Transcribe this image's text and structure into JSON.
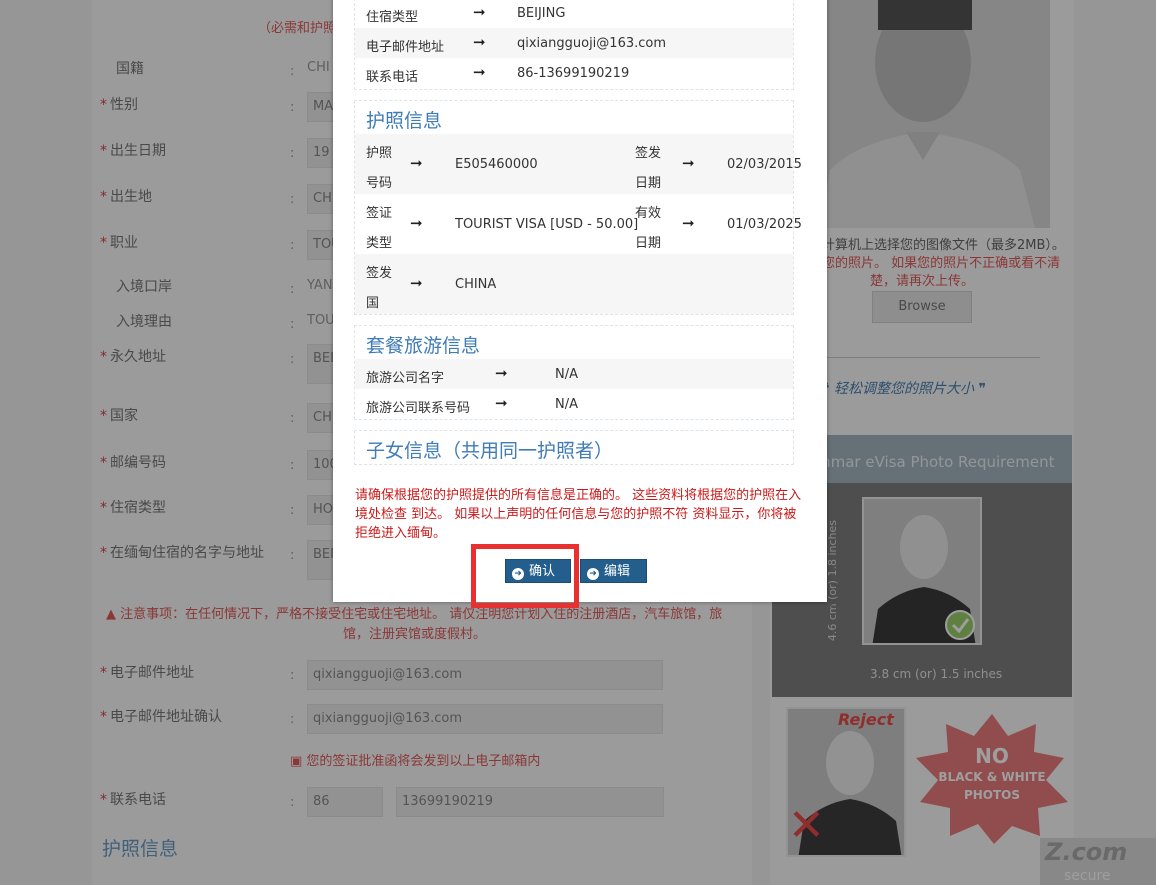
{
  "background": {
    "top_note": "（必需和护照一",
    "fields": [
      {
        "label": "国籍",
        "required": false,
        "value": "CHI"
      },
      {
        "label": "性别",
        "required": true,
        "value": "MA"
      },
      {
        "label": "出生日期",
        "required": true,
        "value": "19"
      },
      {
        "label": "出生地",
        "required": true,
        "value": "CH"
      },
      {
        "label": "职业",
        "required": true,
        "value": "TOU"
      },
      {
        "label": "入境口岸",
        "required": false,
        "value": "YAN"
      },
      {
        "label": "入境理由",
        "required": false,
        "value": "TOU"
      },
      {
        "label": "永久地址",
        "required": true,
        "value": "BEI"
      },
      {
        "label": "国家",
        "required": true,
        "value": "CH"
      },
      {
        "label": "邮编号码",
        "required": true,
        "value": "100"
      },
      {
        "label": "住宿类型",
        "required": true,
        "value": "HO"
      },
      {
        "label": "在缅甸住宿的名字与地址",
        "required": true,
        "value": "BEI"
      }
    ],
    "notice": "注意事项：在任何情况下，严格不接受住宅或住宅地址。 请仅注明您计划入住的注册酒店，汽车旅馆，旅",
    "notice_line2": "馆，注册宾馆或度假村。",
    "email_label": "电子邮件地址",
    "email_value": "qixiangguoji@163.com",
    "email_confirm_label": "电子邮件地址确认",
    "email_confirm_value": "qixiangguoji@163.com",
    "email_note": "您的签证批准函将会发到以上电子邮箱内",
    "phone_label": "联系电话",
    "phone_code": "86",
    "phone_number": "13699190219",
    "section_passport": "护照信息"
  },
  "right_column": {
    "upload_hint_1": "计算机上选择您的图像文件（最多2MB）。",
    "upload_hint_2": "您的照片。 如果您的照片不正确或看不清",
    "upload_hint_3": "楚，请再次上传。",
    "browse_label": "Browse",
    "resize_link": "轻松调整您的照片大小",
    "requirement_title": "mmar eVisa Photo Requirement",
    "photo_height": "4.6 cm (or) 1.8 inches",
    "photo_width": "3.8 cm (or) 1.5 inches",
    "reject_label": "Reject",
    "no_bw_line1": "NO",
    "no_bw_line2": "BLACK & WHITE",
    "no_bw_line3": "PHOTOS",
    "watermark_logo": "Z.com",
    "watermark_sub": "secure"
  },
  "modal": {
    "contact_rows": [
      {
        "label": "住宿类型",
        "value": "BEIJING"
      },
      {
        "label": "电子邮件地址",
        "value": "qixiangguoji@163.com"
      },
      {
        "label": "联系电话",
        "value": "86-13699190219"
      }
    ],
    "passport_title": "护照信息",
    "passport_rows": [
      {
        "l1": "护照",
        "l2": "号码",
        "v1": "E505460000",
        "rl1": "签发",
        "rl2": "日期",
        "rv": "02/03/2015"
      },
      {
        "l1": "签证",
        "l2": "类型",
        "v1": "TOURIST VISA [USD - 50.00]",
        "rl1": "有效",
        "rl2": "日期",
        "rv": "01/03/2025"
      },
      {
        "l1": "签发",
        "l2": "国",
        "v1": "CHINA",
        "rl1": "",
        "rl2": "",
        "rv": ""
      }
    ],
    "tour_title": "套餐旅游信息",
    "tour_rows": [
      {
        "label": "旅游公司名字",
        "value": "N/A"
      },
      {
        "label": "旅游公司联系号码",
        "value": "N/A"
      }
    ],
    "children_title": "子女信息（共用同一护照者）",
    "warning": "请确保根据您的护照提供的所有信息是正确的。 这些资料将根据您的护照在入境处检查 到达。 如果以上声明的任何信息与您的护照不符 资料显示，你将被拒绝进入缅甸。",
    "confirm_label": "确认",
    "edit_label": "编辑",
    "arrow": "➞"
  }
}
